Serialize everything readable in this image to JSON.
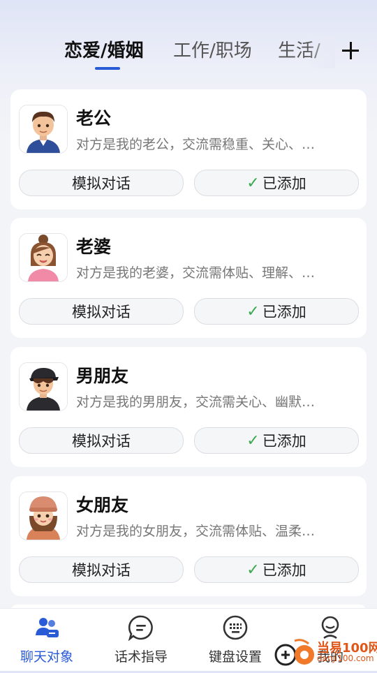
{
  "tabs": {
    "items": [
      {
        "label": "恋爱/婚姻"
      },
      {
        "label": "工作/职场"
      },
      {
        "label": "生活/"
      }
    ],
    "active_index": 0
  },
  "cards": [
    {
      "title": "老公",
      "description": "对方是我的老公，交流需稳重、关心、…",
      "simulate_label": "模拟对话",
      "added_label": "已添加",
      "avatar_icon": "boy-avatar-blue-hoodie"
    },
    {
      "title": "老婆",
      "description": "对方是我的老婆，交流需体贴、理解、…",
      "simulate_label": "模拟对话",
      "added_label": "已添加",
      "avatar_icon": "girl-avatar-bun"
    },
    {
      "title": "男朋友",
      "description": "对方是我的男朋友，交流需关心、幽默…",
      "simulate_label": "模拟对话",
      "added_label": "已添加",
      "avatar_icon": "boy-avatar-cap"
    },
    {
      "title": "女朋友",
      "description": "对方是我的女朋友，交流需体贴、温柔…",
      "simulate_label": "模拟对话",
      "added_label": "已添加",
      "avatar_icon": "girl-avatar-beanie"
    }
  ],
  "bottom_nav": [
    {
      "label": "聊天对象",
      "icon": "contacts-icon",
      "active": true
    },
    {
      "label": "话术指导",
      "icon": "chat-bubble-icon",
      "active": false
    },
    {
      "label": "键盘设置",
      "icon": "keyboard-icon",
      "active": false
    },
    {
      "label": "我的",
      "icon": "profile-icon",
      "active": false
    }
  ],
  "watermark": {
    "text": "当易100网",
    "url": "danji100.com"
  },
  "colors": {
    "accent": "#2a5bd7",
    "check": "#3aa84f",
    "watermark": "#e1571a"
  }
}
